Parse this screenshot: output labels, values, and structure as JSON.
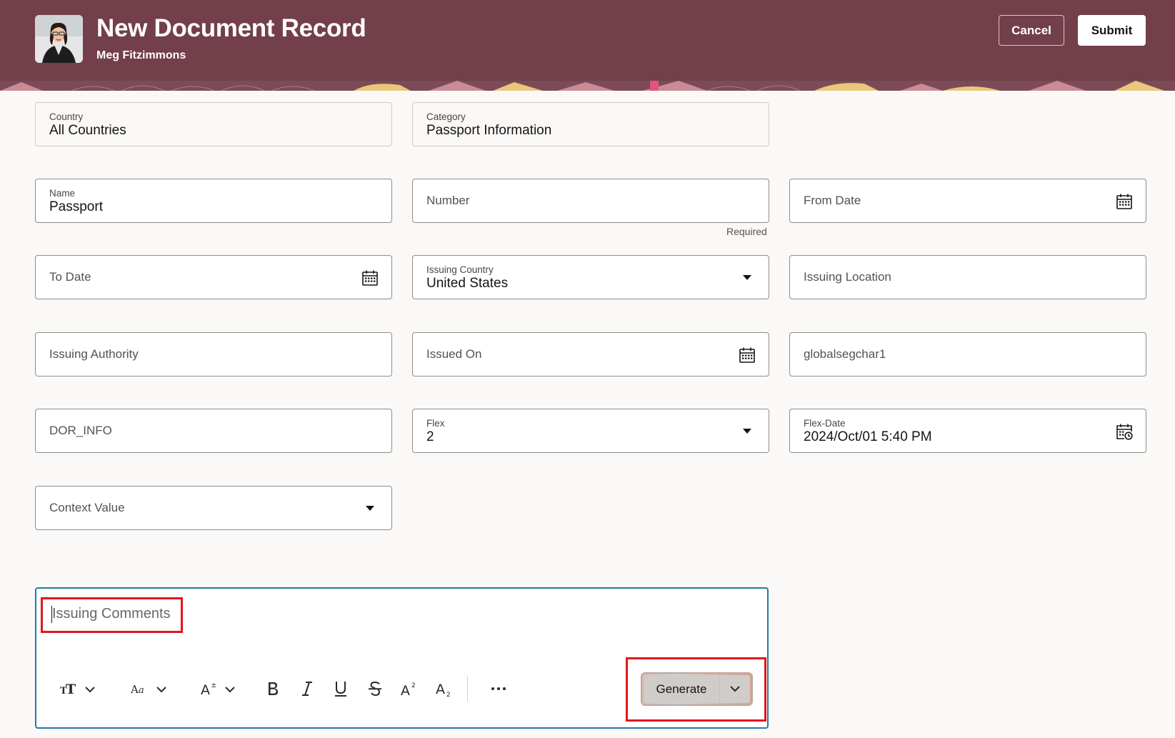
{
  "header": {
    "title": "New Document Record",
    "subtitle": "Meg Fitzimmons",
    "cancel_label": "Cancel",
    "submit_label": "Submit",
    "brand_color": "#723f4b"
  },
  "fields": {
    "country": {
      "label": "Country",
      "value": "All Countries"
    },
    "category": {
      "label": "Category",
      "value": "Passport Information"
    },
    "name": {
      "label": "Name",
      "value": "Passport"
    },
    "number": {
      "label": "Number",
      "helper": "Required"
    },
    "from_date": {
      "label": "From Date",
      "icon": "calendar-icon"
    },
    "to_date": {
      "label": "To Date",
      "icon": "calendar-icon"
    },
    "issuing_country": {
      "label": "Issuing Country",
      "value": "United States"
    },
    "issuing_location": {
      "label": "Issuing Location"
    },
    "issuing_authority": {
      "label": "Issuing Authority"
    },
    "issued_on": {
      "label": "Issued On",
      "icon": "calendar-icon"
    },
    "globalsegchar1": {
      "label": "globalsegchar1"
    },
    "dor_info": {
      "label": "DOR_INFO"
    },
    "flex": {
      "label": "Flex",
      "value": "2"
    },
    "flex_date": {
      "label": "Flex-Date",
      "value": "2024/Oct/01 5:40 PM",
      "icon": "calendar-clock-icon"
    },
    "context_value": {
      "label": "Context Value"
    }
  },
  "editor": {
    "placeholder": "Issuing Comments",
    "toolbar": [
      "text-style-icon",
      "font-size-icon",
      "text-size-adjust-icon",
      "bold-icon",
      "italic-icon",
      "underline-icon",
      "strikethrough-icon",
      "superscript-icon",
      "subscript-icon",
      "more-icon"
    ],
    "generate_label": "Generate"
  },
  "colors": {
    "focus_border": "#227aa6",
    "highlight": "#e0171e"
  }
}
